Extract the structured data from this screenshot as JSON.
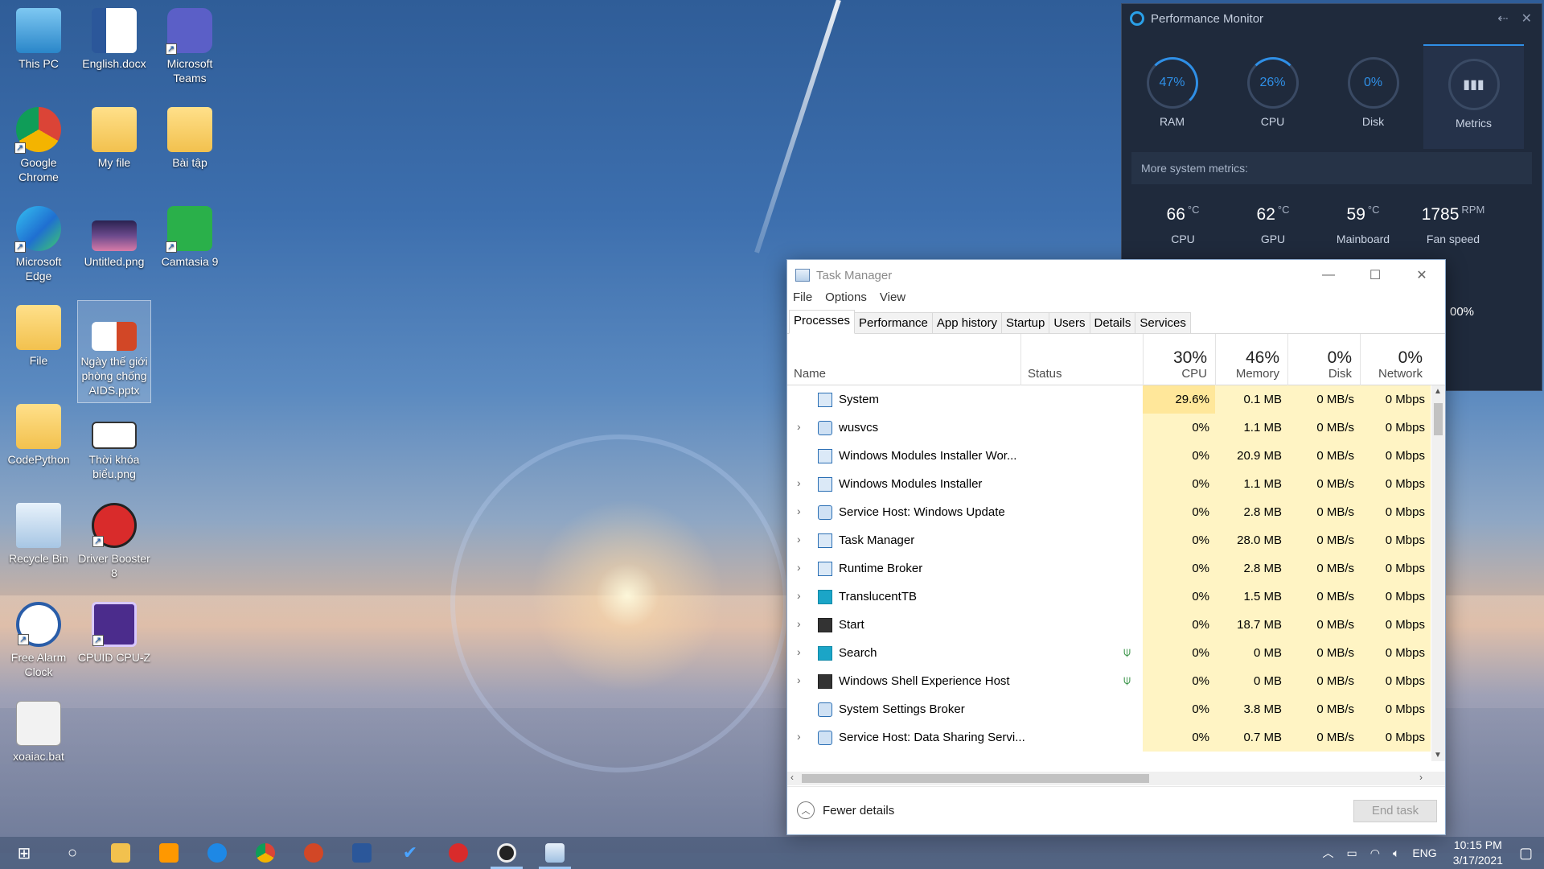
{
  "desktop": {
    "icons": [
      {
        "label": "This PC"
      },
      {
        "label": "English.docx"
      },
      {
        "label": "Microsoft Teams"
      },
      {
        "label": "Google Chrome"
      },
      {
        "label": "My file"
      },
      {
        "label": "Bài tập"
      },
      {
        "label": "Microsoft Edge"
      },
      {
        "label": "Untitled.png"
      },
      {
        "label": "Camtasia 9"
      },
      {
        "label": "File"
      },
      {
        "label": "Ngày thế giới phòng chống AIDS.pptx"
      },
      {
        "label": "CodePython"
      },
      {
        "label": "Thời khóa biểu.png"
      },
      {
        "label": "Recycle Bin"
      },
      {
        "label": "Driver Booster 8"
      },
      {
        "label": "Free Alarm Clock"
      },
      {
        "label": "CPUID CPU-Z"
      },
      {
        "label": "xoaiac.bat"
      }
    ]
  },
  "perf_monitor": {
    "title": "Performance Monitor",
    "gauges": [
      {
        "value": "47%",
        "label": "RAM"
      },
      {
        "value": "26%",
        "label": "CPU"
      },
      {
        "value": "0%",
        "label": "Disk"
      },
      {
        "value": "",
        "label": "Metrics"
      }
    ],
    "more_metrics": "More system metrics:",
    "temps": [
      {
        "value": "66",
        "unit": "°C",
        "label": "CPU"
      },
      {
        "value": "62",
        "unit": "°C",
        "label": "GPU"
      },
      {
        "value": "59",
        "unit": "°C",
        "label": "Mainboard"
      },
      {
        "value": "1785",
        "unit": "RPM",
        "label": "Fan speed"
      }
    ],
    "partial_value": "00%"
  },
  "task_manager": {
    "title": "Task Manager",
    "menu": [
      "File",
      "Options",
      "View"
    ],
    "tabs": [
      "Processes",
      "Performance",
      "App history",
      "Startup",
      "Users",
      "Details",
      "Services"
    ],
    "columns": {
      "name": "Name",
      "status": "Status",
      "cpu": {
        "pct": "30%",
        "label": "CPU"
      },
      "memory": {
        "pct": "46%",
        "label": "Memory"
      },
      "disk": {
        "pct": "0%",
        "label": "Disk"
      },
      "network": {
        "pct": "0%",
        "label": "Network"
      }
    },
    "processes": [
      {
        "name": "System",
        "cpu": "29.6%",
        "memory": "0.1 MB",
        "disk": "0 MB/s",
        "network": "0 Mbps"
      },
      {
        "name": "wusvcs",
        "cpu": "0%",
        "memory": "1.1 MB",
        "disk": "0 MB/s",
        "network": "0 Mbps"
      },
      {
        "name": "Windows Modules Installer Wor...",
        "cpu": "0%",
        "memory": "20.9 MB",
        "disk": "0 MB/s",
        "network": "0 Mbps"
      },
      {
        "name": "Windows Modules Installer",
        "cpu": "0%",
        "memory": "1.1 MB",
        "disk": "0 MB/s",
        "network": "0 Mbps"
      },
      {
        "name": "Service Host: Windows Update",
        "cpu": "0%",
        "memory": "2.8 MB",
        "disk": "0 MB/s",
        "network": "0 Mbps"
      },
      {
        "name": "Task Manager",
        "cpu": "0%",
        "memory": "28.0 MB",
        "disk": "0 MB/s",
        "network": "0 Mbps"
      },
      {
        "name": "Runtime Broker",
        "cpu": "0%",
        "memory": "2.8 MB",
        "disk": "0 MB/s",
        "network": "0 Mbps"
      },
      {
        "name": "TranslucentTB",
        "cpu": "0%",
        "memory": "1.5 MB",
        "disk": "0 MB/s",
        "network": "0 Mbps"
      },
      {
        "name": "Start",
        "cpu": "0%",
        "memory": "18.7 MB",
        "disk": "0 MB/s",
        "network": "0 Mbps"
      },
      {
        "name": "Search",
        "cpu": "0%",
        "memory": "0 MB",
        "disk": "0 MB/s",
        "network": "0 Mbps"
      },
      {
        "name": "Windows Shell Experience Host",
        "cpu": "0%",
        "memory": "0 MB",
        "disk": "0 MB/s",
        "network": "0 Mbps"
      },
      {
        "name": "System Settings Broker",
        "cpu": "0%",
        "memory": "3.8 MB",
        "disk": "0 MB/s",
        "network": "0 Mbps"
      },
      {
        "name": "Service Host: Data Sharing Servi...",
        "cpu": "0%",
        "memory": "0.7 MB",
        "disk": "0 MB/s",
        "network": "0 Mbps"
      }
    ],
    "fewer_details": "Fewer details",
    "end_task": "End task"
  },
  "taskbar": {
    "tray_lang": "ENG",
    "time": "10:15 PM",
    "date": "3/17/2021"
  },
  "colors": {
    "cpu_highlight": "#ffe79a",
    "cell_shade": "#fff4c4",
    "perf_bg": "#1f2a3c",
    "accent": "#2f8fe6"
  }
}
